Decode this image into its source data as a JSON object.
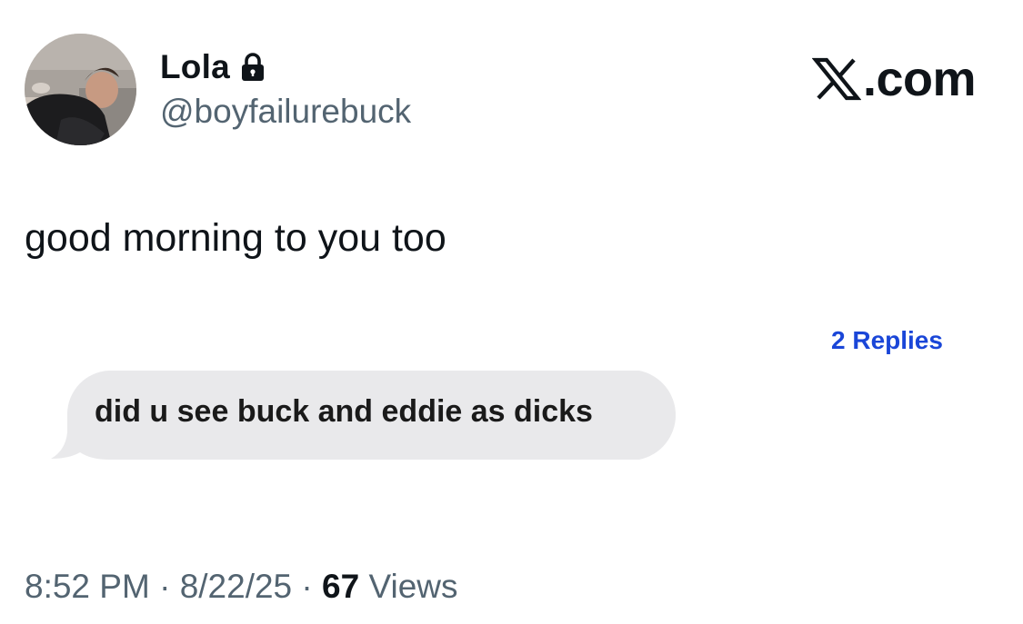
{
  "author": {
    "display_name": "Lola",
    "handle": "@boyfailurebuck",
    "protected_icon": "lock-icon",
    "avatar_icon": "profile-photo"
  },
  "brand": {
    "text": ".com",
    "icon": "x-logo-icon"
  },
  "tweet": {
    "text": "good morning to you too"
  },
  "replies_link": "2 Replies",
  "message_bubble": {
    "text": "did u see buck and eddie as dicks"
  },
  "meta": {
    "time": "8:52 PM",
    "separator": "·",
    "date": "8/22/25",
    "views_count": "67",
    "views_label": "Views"
  },
  "colors": {
    "text_primary": "#0f1419",
    "text_secondary": "#536471",
    "link_blue": "#1a46d8",
    "bubble_gray": "#e9e9eb"
  }
}
